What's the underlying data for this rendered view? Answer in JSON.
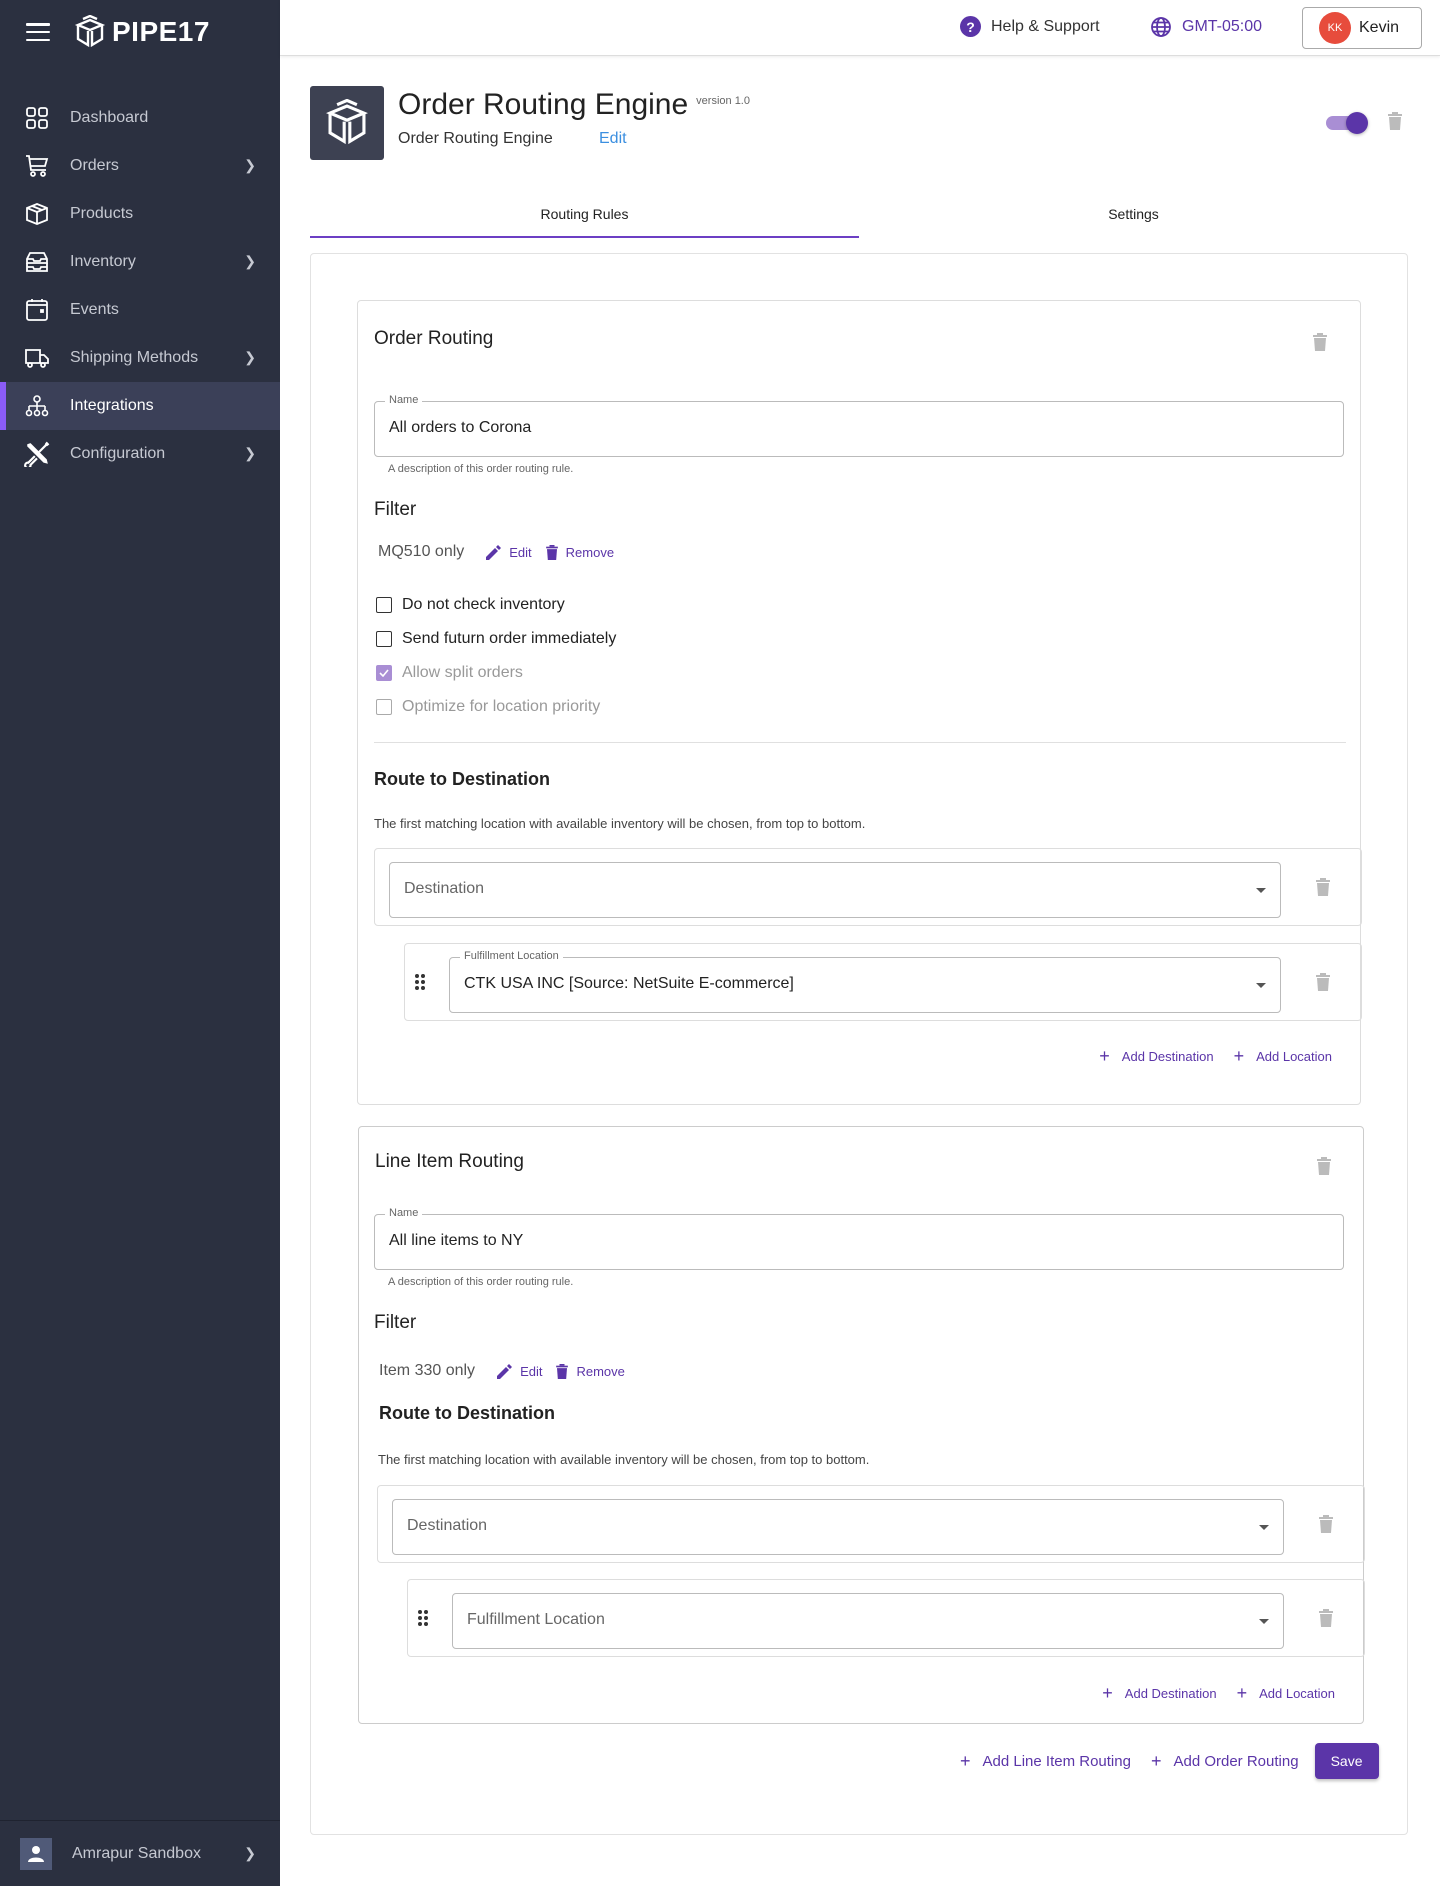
{
  "brand": {
    "name": "PIPE17",
    "accent": "#5b35a8",
    "sidebar_bg": "#2b3040"
  },
  "sidebar": {
    "items": [
      {
        "label": "Dashboard",
        "icon": "dashboard-grid-icon",
        "has_submenu": false
      },
      {
        "label": "Orders",
        "icon": "cart-icon",
        "has_submenu": true
      },
      {
        "label": "Products",
        "icon": "box-icon",
        "has_submenu": false
      },
      {
        "label": "Inventory",
        "icon": "inventory-tray-icon",
        "has_submenu": true
      },
      {
        "label": "Events",
        "icon": "calendar-icon",
        "has_submenu": false
      },
      {
        "label": "Shipping Methods",
        "icon": "truck-icon",
        "has_submenu": true
      },
      {
        "label": "Integrations",
        "icon": "network-icon",
        "has_submenu": false,
        "active": true
      },
      {
        "label": "Configuration",
        "icon": "tools-icon",
        "has_submenu": true
      }
    ],
    "account": {
      "label": "Amrapur Sandbox"
    }
  },
  "topbar": {
    "help_label": "Help & Support",
    "timezone": "GMT-05:00",
    "user": {
      "initials": "KK",
      "name": "Kevin"
    }
  },
  "header": {
    "title": "Order Routing Engine",
    "version": "version 1.0",
    "subtitle": "Order Routing Engine",
    "edit_label": "Edit",
    "enabled": true
  },
  "tabs": [
    {
      "label": "Routing Rules",
      "active": true
    },
    {
      "label": "Settings",
      "active": false
    }
  ],
  "order_routing": {
    "title": "Order Routing",
    "name_label": "Name",
    "name_value": "All orders to Corona",
    "name_helper": "A description of this order routing rule.",
    "filter_heading": "Filter",
    "filter_value": "MQ510 only",
    "edit_label": "Edit",
    "remove_label": "Remove",
    "options": [
      {
        "label": "Do not check inventory",
        "checked": false,
        "disabled": false
      },
      {
        "label": "Send futurn order immediately",
        "checked": false,
        "disabled": false
      },
      {
        "label": "Allow split orders",
        "checked": true,
        "disabled": true
      },
      {
        "label": "Optimize for location priority",
        "checked": false,
        "disabled": true
      }
    ],
    "route_heading": "Route to Destination",
    "route_desc": "The first matching location with available inventory will be chosen, from top to bottom.",
    "destination_placeholder": "Destination",
    "location_label": "Fulfillment Location",
    "location_value": "CTK USA INC [Source: NetSuite E-commerce]",
    "add_destination": "Add Destination",
    "add_location": "Add Location"
  },
  "line_item_routing": {
    "title": "Line Item Routing",
    "name_label": "Name",
    "name_value": "All line items to NY",
    "name_helper": "A description of this order routing rule.",
    "filter_heading": "Filter",
    "filter_value": "Item 330 only",
    "edit_label": "Edit",
    "remove_label": "Remove",
    "route_heading": "Route to Destination",
    "route_desc": "The first matching location with available inventory will be chosen, from top to bottom.",
    "destination_placeholder": "Destination",
    "location_placeholder": "Fulfillment Location",
    "add_destination": "Add Destination",
    "add_location": "Add Location"
  },
  "footer_actions": {
    "add_line_item_routing": "Add Line Item Routing",
    "add_order_routing": "Add Order Routing",
    "save": "Save"
  }
}
